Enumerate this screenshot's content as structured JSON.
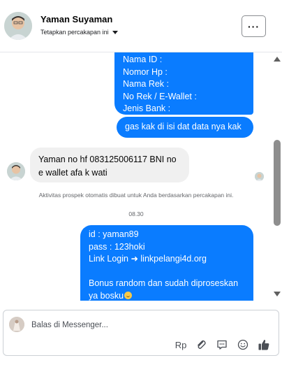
{
  "header": {
    "contact_name": "Yaman Suyaman",
    "subtitle": "Tetapkan percakapan ini",
    "more_label": "···"
  },
  "messages": {
    "form_lines": [
      "Nama ID :",
      "Nomor Hp :",
      "Nama Rek :",
      "No Rek / E-Wallet :",
      "Jenis Bank :"
    ],
    "gas": "gas kak di isi dat data nya kak",
    "incoming_1": "Yaman no hf 083125006117 BNI no",
    "incoming_2": "e wallet afa k wati",
    "system_note": "Aktivitas prospek otomatis dibuat untuk Anda berdasarkan percakapan ini.",
    "timestamp": "08.30",
    "login_lines": [
      "id : yaman89",
      "pass : 123hoki",
      "Link Login ➜ linkpelangi4d.org"
    ],
    "bonus_1": "Bonus random dan sudah diproseskan",
    "bonus_2": "ya bosku"
  },
  "composer": {
    "placeholder": "Balas di Messenger...",
    "currency_label": "Rp"
  },
  "icons": [
    "more-icon",
    "caret-down-icon",
    "attachment-icon",
    "quick-reply-icon",
    "emoji-icon",
    "thumbs-up-icon"
  ],
  "colors": {
    "outgoing_bubble": "#0a7cff",
    "incoming_bubble": "#f0f0f0",
    "like_icon": "#4b4f56"
  }
}
